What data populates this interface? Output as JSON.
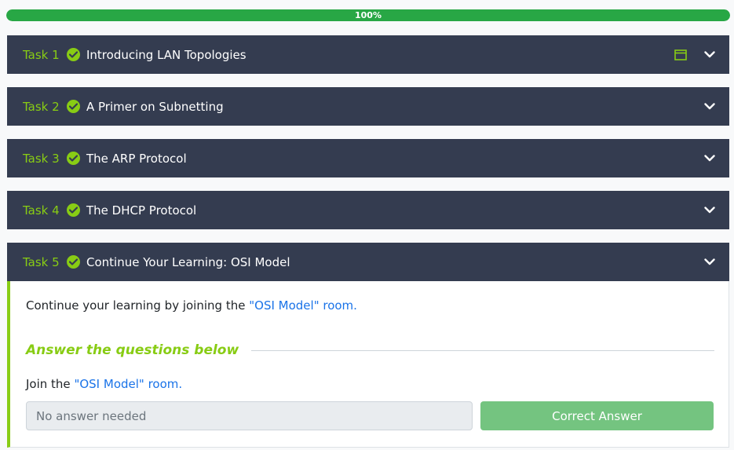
{
  "progress": {
    "label": "100%",
    "value": 1.0
  },
  "tasks": [
    {
      "number": "Task 1",
      "title": "Introducing LAN Topologies"
    },
    {
      "number": "Task 2",
      "title": "A Primer on Subnetting"
    },
    {
      "number": "Task 3",
      "title": "The ARP Protocol"
    },
    {
      "number": "Task 4",
      "title": "The DHCP Protocol"
    },
    {
      "number": "Task 5",
      "title": "Continue Your Learning: OSI Model"
    }
  ],
  "task5_content": {
    "intro_text": "Continue your learning by joining the",
    "intro_link": "\"OSI Model\" room.",
    "answer_heading": "Answer the questions below",
    "question_text": "Join the",
    "question_link": "\"OSI Model\" room.",
    "answer_placeholder": "No answer needed",
    "submit_label": "Correct Answer"
  },
  "colors": {
    "accent": "#88cc14",
    "header_bg": "#343c50",
    "progress": "#28a745",
    "link": "#1a73e8",
    "correct_button": "#74c480"
  },
  "icons": {
    "completed": "check-circle-icon",
    "split_view": "window-icon",
    "expand": "chevron-down-icon"
  }
}
